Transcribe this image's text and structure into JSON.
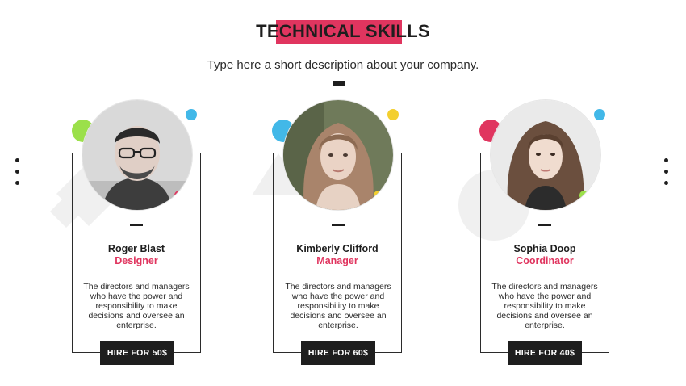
{
  "header": {
    "title": "TECHNICAL SKILLS",
    "subtitle": "Type here a short description about your company."
  },
  "colors": {
    "accent": "#e0355f",
    "dark": "#1e1e1e",
    "blue": "#42b8e8",
    "lime": "#9be04a",
    "yellow": "#f3cf2f"
  },
  "cards": [
    {
      "name": "Roger Blast",
      "role": "Designer",
      "description": "The directors and managers who have the power and responsibility to make decisions and oversee an enterprise.",
      "button": "HIRE FOR 50$"
    },
    {
      "name": "Kimberly Clifford",
      "role": "Manager",
      "description": "The directors and managers who have the power and responsibility to make decisions and oversee an enterprise.",
      "button": "HIRE FOR 60$"
    },
    {
      "name": "Sophia Doop",
      "role": "Coordinator",
      "description": "The directors and managers who have the power and responsibility to make decisions and oversee an enterprise.",
      "button": "HIRE FOR 40$"
    }
  ]
}
